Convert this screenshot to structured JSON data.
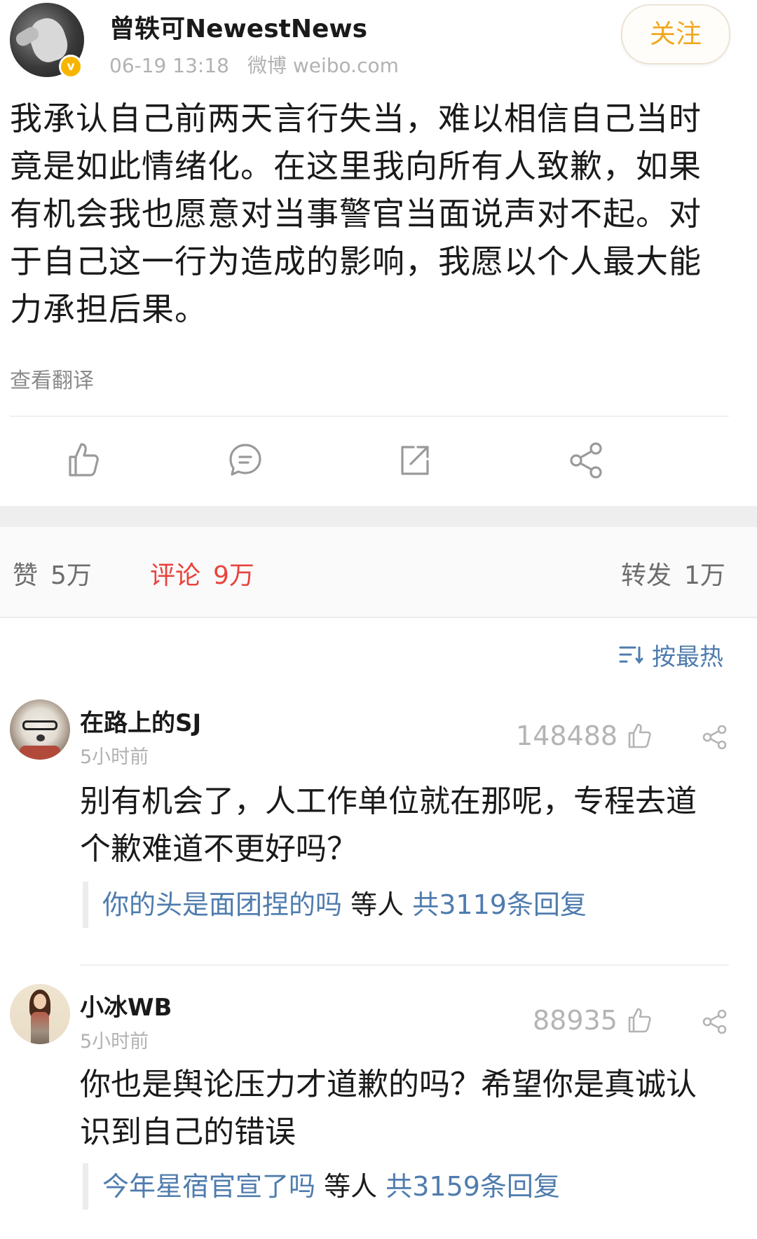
{
  "post": {
    "author": "曾轶可NewestNews",
    "time": "06-19 13:18",
    "source": "微博 weibo.com",
    "follow_label": "关注",
    "content": "我承认自己前两天言行失当，难以相信自己当时竟是如此情绪化。在这里我向所有人致歉，如果有机会我也愿意对当事警官当面说声对不起。对于自己这一行为造成的影响，我愿以个人最大能力承担后果。",
    "translate_label": "查看翻译",
    "verified_badge": "v"
  },
  "actions": [
    {
      "name": "like",
      "icon": "thumbs-up-icon"
    },
    {
      "name": "comment",
      "icon": "comment-icon"
    },
    {
      "name": "repost",
      "icon": "repost-icon"
    },
    {
      "name": "share",
      "icon": "share-icon"
    }
  ],
  "stats": {
    "likes_label": "赞",
    "likes_count": "5万",
    "comments_label": "评论",
    "comments_count": "9万",
    "reposts_label": "转发",
    "reposts_count": "1万"
  },
  "sort": {
    "label": "按最热",
    "icon": "sort-icon"
  },
  "comments": [
    {
      "author": "在路上的SJ",
      "time": "5小时前",
      "likes": "148488",
      "text": "别有机会了，人工作单位就在那呢，专程去道个歉难道不更好吗？",
      "reply_user": "你的头是面团捏的吗",
      "reply_others": "等人",
      "reply_count": "共3119条回复"
    },
    {
      "author": "小冰WB",
      "time": "5小时前",
      "likes": "88935",
      "text": "你也是舆论压力才道歉的吗？希望你是真诚认识到自己的错误",
      "reply_user": "今年星宿官宣了吗",
      "reply_others": "等人",
      "reply_count": "共3159条回复"
    }
  ],
  "colors": {
    "accent_red": "#e8433c",
    "link_blue": "#4f7cae",
    "follow_orange": "#f0a91f",
    "muted_gray": "#b2b2b2"
  }
}
